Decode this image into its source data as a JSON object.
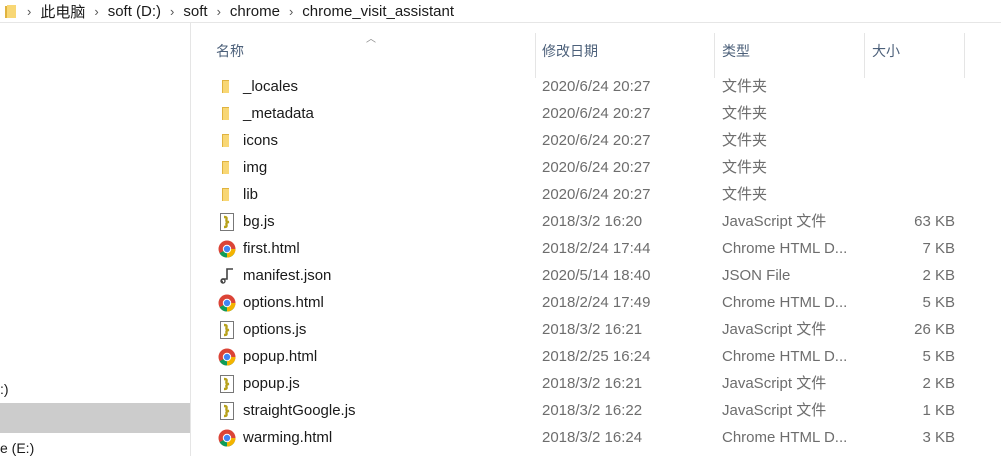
{
  "breadcrumb": [
    "此电脑",
    "soft (D:)",
    "soft",
    "chrome",
    "chrome_visit_assistant"
  ],
  "nav": {
    "items": [
      {
        "label": ":)",
        "selected": false
      },
      {
        "label": "",
        "selected": true
      },
      {
        "label": "e (E:)",
        "selected": false
      }
    ]
  },
  "columns": {
    "name": "名称",
    "date": "修改日期",
    "type": "类型",
    "size": "大小"
  },
  "files": [
    {
      "name": "_locales",
      "date": "2020/6/24 20:27",
      "type": "文件夹",
      "size": "",
      "icon": "folder-icon"
    },
    {
      "name": "_metadata",
      "date": "2020/6/24 20:27",
      "type": "文件夹",
      "size": "",
      "icon": "folder-icon"
    },
    {
      "name": "icons",
      "date": "2020/6/24 20:27",
      "type": "文件夹",
      "size": "",
      "icon": "folder-icon"
    },
    {
      "name": "img",
      "date": "2020/6/24 20:27",
      "type": "文件夹",
      "size": "",
      "icon": "folder-icon"
    },
    {
      "name": "lib",
      "date": "2020/6/24 20:27",
      "type": "文件夹",
      "size": "",
      "icon": "folder-icon"
    },
    {
      "name": "bg.js",
      "date": "2018/3/2 16:20",
      "type": "JavaScript 文件",
      "size": "63 KB",
      "icon": "js-file-icon"
    },
    {
      "name": "first.html",
      "date": "2018/2/24 17:44",
      "type": "Chrome HTML D...",
      "size": "7 KB",
      "icon": "chrome-icon"
    },
    {
      "name": "manifest.json",
      "date": "2020/5/14 18:40",
      "type": "JSON File",
      "size": "2 KB",
      "icon": "json-file-icon"
    },
    {
      "name": "options.html",
      "date": "2018/2/24 17:49",
      "type": "Chrome HTML D...",
      "size": "5 KB",
      "icon": "chrome-icon"
    },
    {
      "name": "options.js",
      "date": "2018/3/2 16:21",
      "type": "JavaScript 文件",
      "size": "26 KB",
      "icon": "js-file-icon"
    },
    {
      "name": "popup.html",
      "date": "2018/2/25 16:24",
      "type": "Chrome HTML D...",
      "size": "5 KB",
      "icon": "chrome-icon"
    },
    {
      "name": "popup.js",
      "date": "2018/3/2 16:21",
      "type": "JavaScript 文件",
      "size": "2 KB",
      "icon": "js-file-icon"
    },
    {
      "name": "straightGoogle.js",
      "date": "2018/3/2 16:22",
      "type": "JavaScript 文件",
      "size": "1 KB",
      "icon": "js-file-icon"
    },
    {
      "name": "warming.html",
      "date": "2018/3/2 16:24",
      "type": "Chrome HTML D...",
      "size": "3 KB",
      "icon": "chrome-icon"
    }
  ],
  "colors": {
    "folder": "#f8d775",
    "folder_dark": "#e0b33f",
    "header_text": "#4c607a",
    "selected_nav": "#cccccc"
  }
}
